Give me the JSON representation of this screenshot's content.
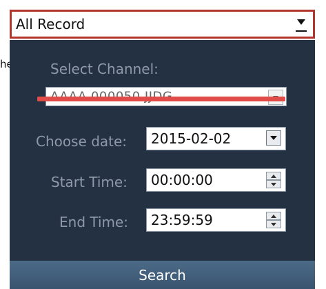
{
  "record_type": {
    "selected": "All Record"
  },
  "stray_text": "he",
  "channel": {
    "label": "Select Channel:",
    "value": "AAAA 000050 JJDG"
  },
  "date": {
    "label": "Choose date:",
    "value": "2015-02-02"
  },
  "start_time": {
    "label": "Start Time:",
    "value": "00:00:00"
  },
  "end_time": {
    "label": "End Time:",
    "value": "23:59:59"
  },
  "search": {
    "label": "Search"
  },
  "colors": {
    "panel_bg": "#233142",
    "label_text": "#8e9aa8",
    "select_border": "#b1352d",
    "redaction": "#e24c48",
    "search_bar": "#42607d"
  }
}
